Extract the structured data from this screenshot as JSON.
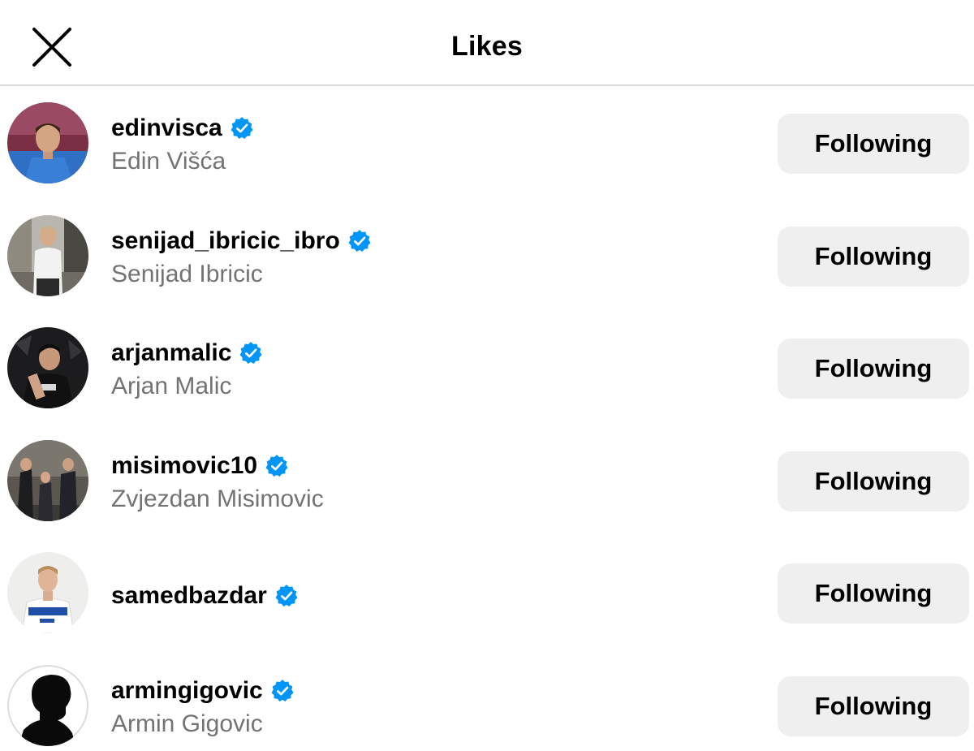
{
  "header": {
    "title": "Likes",
    "close_icon": "close-icon"
  },
  "colors": {
    "verified_blue": "#0095f6",
    "button_bg": "#efefef",
    "secondary_text": "#737373",
    "divider": "#dbdbdb"
  },
  "likes": [
    {
      "username": "edinvisca",
      "full_name": "Edin Višća",
      "verified": true,
      "button_label": "Following"
    },
    {
      "username": "senijad_ibricic_ibro",
      "full_name": "Senijad Ibricic",
      "verified": true,
      "button_label": "Following"
    },
    {
      "username": "arjanmalic",
      "full_name": "Arjan Malic",
      "verified": true,
      "button_label": "Following"
    },
    {
      "username": "misimovic10",
      "full_name": "Zvjezdan Misimovic",
      "verified": true,
      "button_label": "Following"
    },
    {
      "username": "samedbazdar",
      "full_name": "",
      "verified": true,
      "button_label": "Following"
    },
    {
      "username": "armingigovic",
      "full_name": "Armin Gigovic",
      "verified": true,
      "button_label": "Following"
    }
  ]
}
